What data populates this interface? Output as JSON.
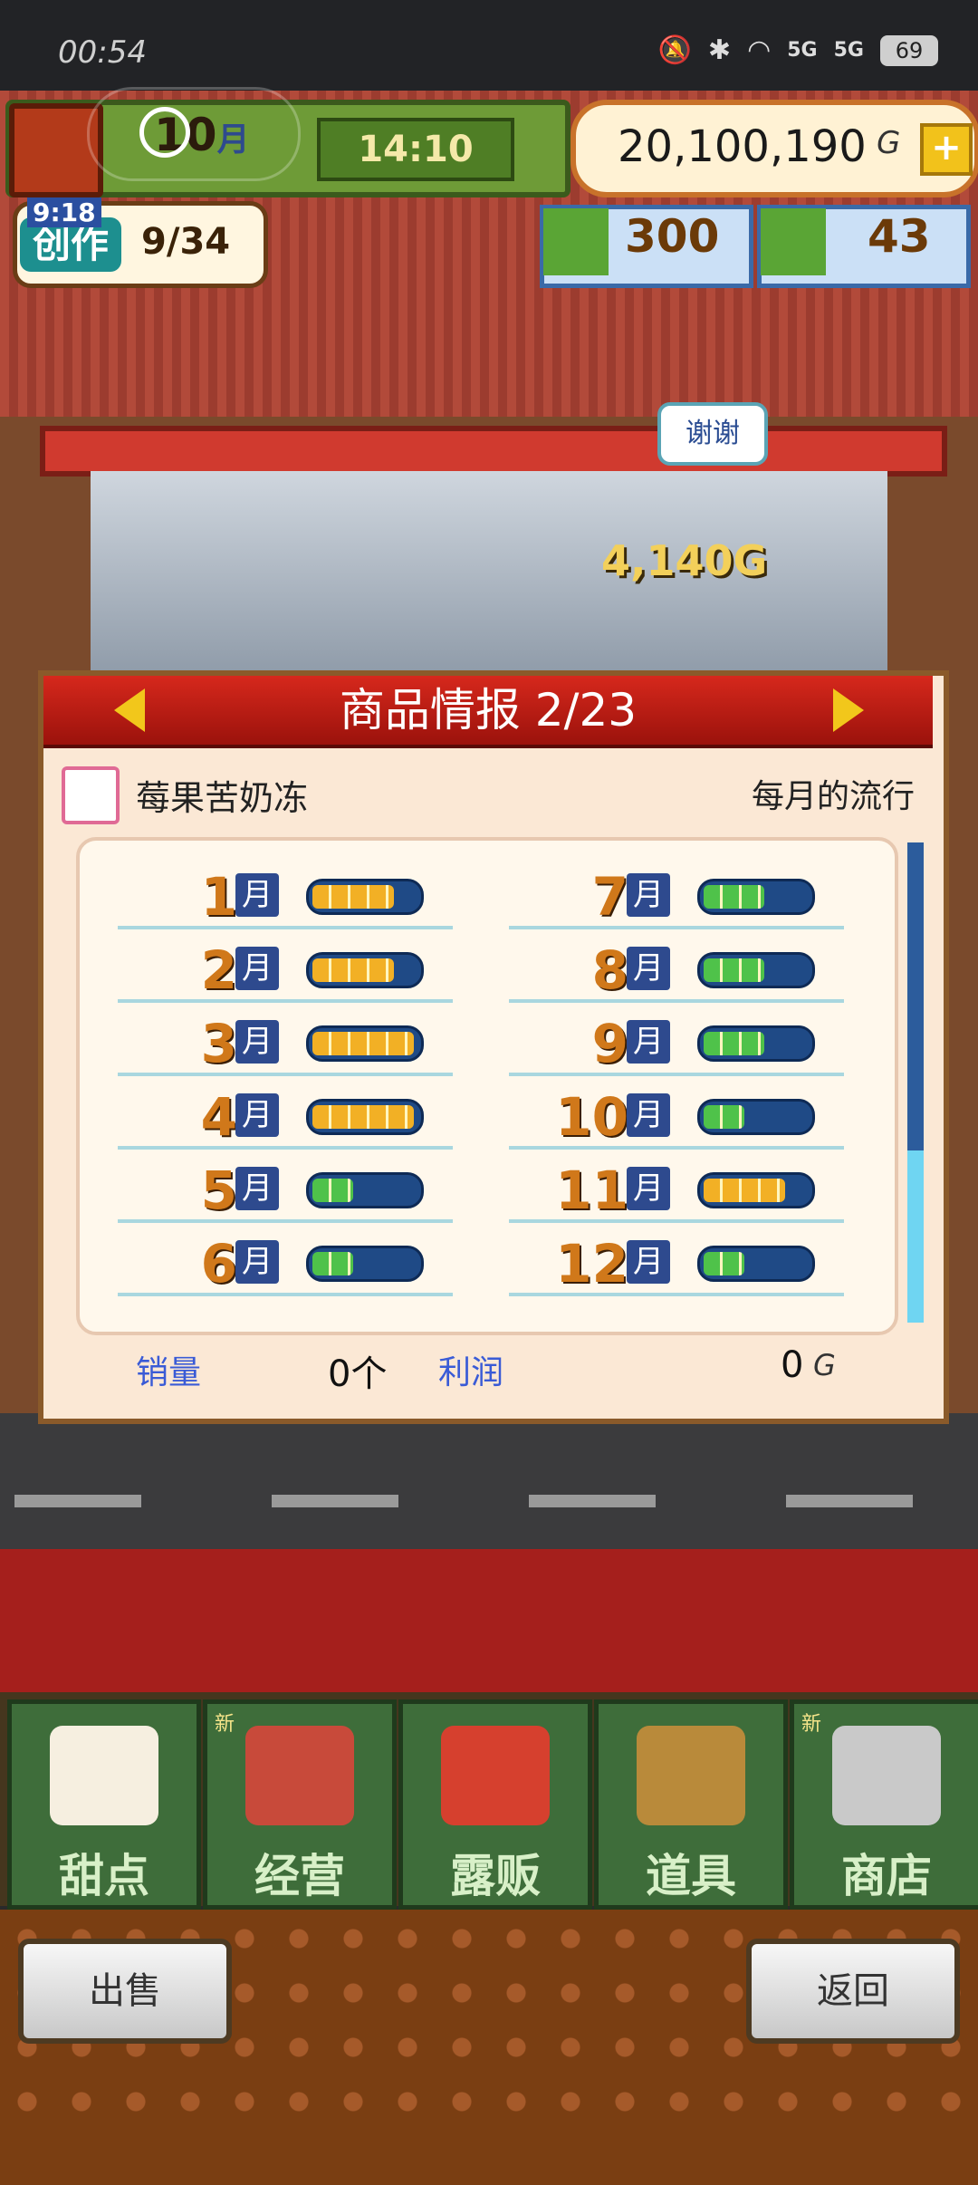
{
  "status_bar": {
    "time": "00:54",
    "battery": "69",
    "signal1": "5G",
    "signal2": "5G"
  },
  "hud": {
    "month_num": "10",
    "month_char": "月",
    "clock": "14:10",
    "money": "20,100,190",
    "money_unit": "G",
    "plus": "+",
    "create_label": "创作",
    "create_timer": "9:18",
    "create_count": "9/34",
    "gold": "300",
    "coins": "43"
  },
  "scene": {
    "thanks_bubble": "谢谢",
    "float_value": "4,140G"
  },
  "panel": {
    "title": "商品情报 2/23",
    "item_name": "莓果苦奶冻",
    "trend_label": "每月的流行",
    "month_suffix": "月",
    "months": [
      {
        "num": "1",
        "level": 4,
        "color": "#f2b025"
      },
      {
        "num": "2",
        "level": 4,
        "color": "#f2b025"
      },
      {
        "num": "3",
        "level": 5,
        "color": "#f2b025"
      },
      {
        "num": "4",
        "level": 5,
        "color": "#f2b025"
      },
      {
        "num": "5",
        "level": 2,
        "color": "#4fc24a"
      },
      {
        "num": "6",
        "level": 2,
        "color": "#4fc24a"
      },
      {
        "num": "7",
        "level": 3,
        "color": "#4fc24a"
      },
      {
        "num": "8",
        "level": 3,
        "color": "#4fc24a"
      },
      {
        "num": "9",
        "level": 3,
        "color": "#4fc24a"
      },
      {
        "num": "10",
        "level": 2,
        "color": "#4fc24a"
      },
      {
        "num": "11",
        "level": 4,
        "color": "#f2b025"
      },
      {
        "num": "12",
        "level": 2,
        "color": "#4fc24a"
      }
    ],
    "sales_label": "销量",
    "sales_value": "0个",
    "profit_label": "利润",
    "profit_value": "0",
    "profit_unit": "G"
  },
  "nav": {
    "items": [
      {
        "label": "甜点",
        "new": "",
        "icon": "cake-icon",
        "color": "#f6efe0"
      },
      {
        "label": "经营",
        "new": "新",
        "icon": "shop-icon",
        "color": "#c84a3a"
      },
      {
        "label": "露贩",
        "new": "",
        "icon": "food-truck-icon",
        "color": "#d6402e"
      },
      {
        "label": "道具",
        "new": "",
        "icon": "gear-bag-icon",
        "color": "#b98a3a"
      },
      {
        "label": "商店",
        "new": "新",
        "icon": "shopping-cart-icon",
        "color": "#c9c9c9"
      }
    ]
  },
  "actions": {
    "sell": "出售",
    "back": "返回"
  }
}
